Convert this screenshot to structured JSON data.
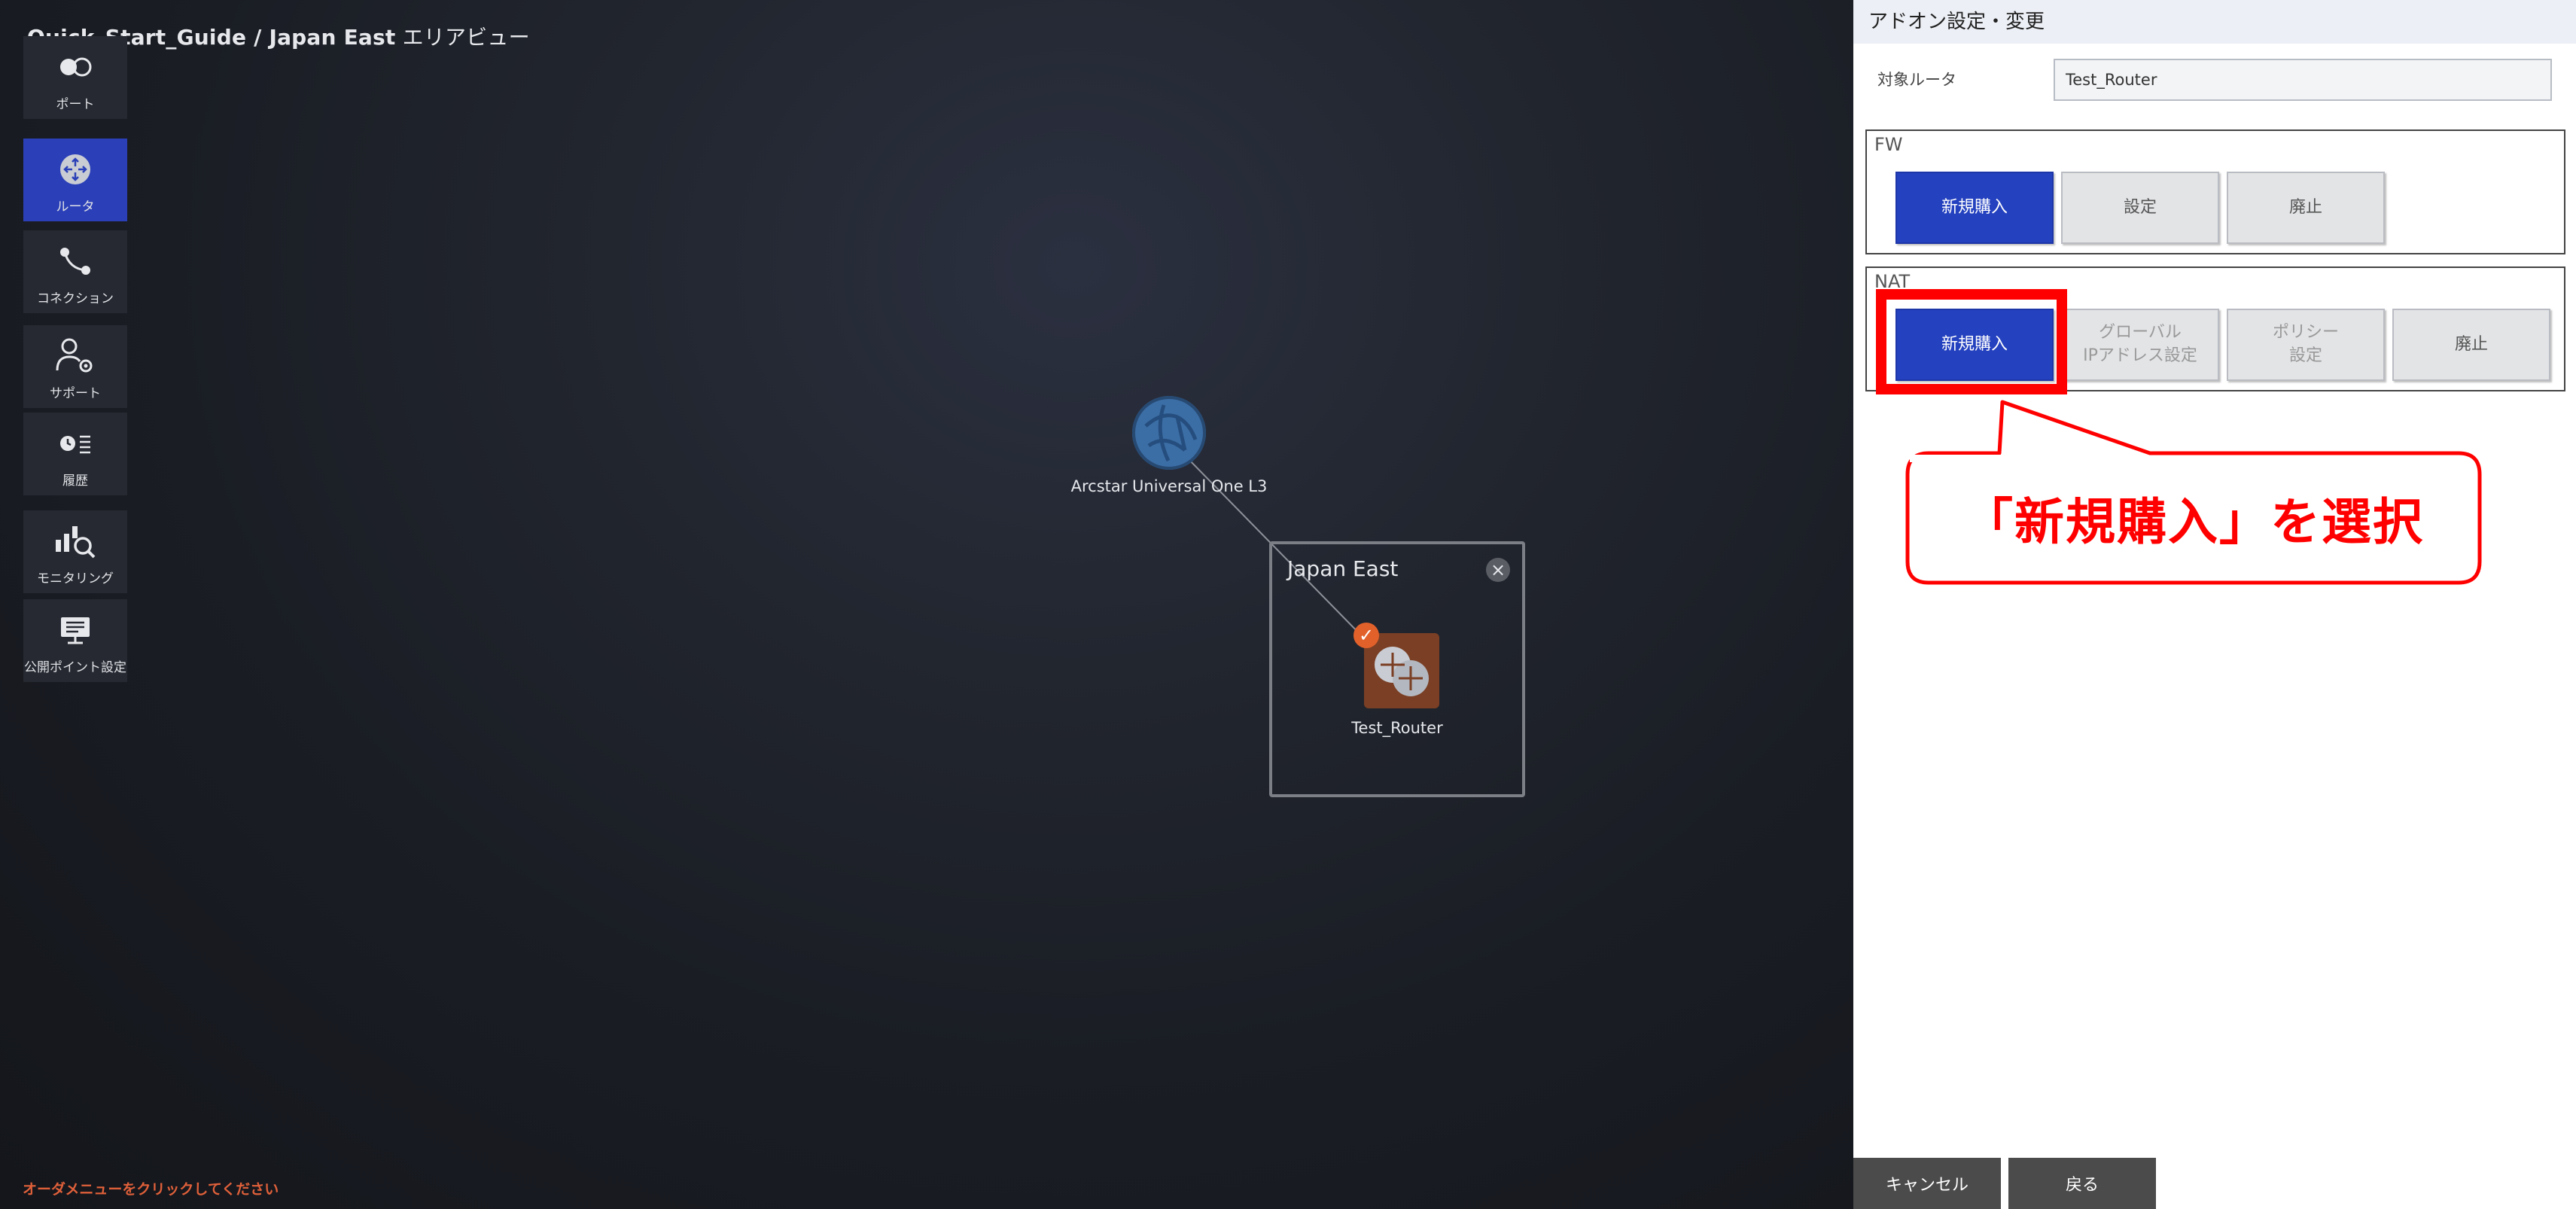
{
  "breadcrumb": {
    "path": "Quick_Start_Guide / Japan East",
    "view": " エリアビュー"
  },
  "sidebar": {
    "items": [
      {
        "label": "ポート",
        "icon": "port-icon"
      },
      {
        "label": "ルータ",
        "icon": "router-icon"
      },
      {
        "label": "コネクション",
        "icon": "connection-icon"
      },
      {
        "label": "サポート",
        "icon": "support-icon"
      },
      {
        "label": "履歴",
        "icon": "history-icon"
      },
      {
        "label": "モニタリング",
        "icon": "monitoring-icon"
      },
      {
        "label": "公開ポイント設定",
        "icon": "public-point-icon"
      }
    ]
  },
  "hint": "オーダメニューをクリックしてください",
  "canvas": {
    "l3_node_label": "Arcstar Universal One L3",
    "area_title": "Japan East",
    "router_label": "Test_Router"
  },
  "panel": {
    "header": "アドオン設定・変更",
    "target_label": "対象ルータ",
    "target_value": "Test_Router",
    "fw": {
      "title": "FW",
      "buttons": [
        "新規購入",
        "設定",
        "廃止"
      ]
    },
    "nat": {
      "title": "NAT",
      "buttons": [
        "新規購入",
        "グローバル\nIPアドレス設定",
        "ポリシー\n設定",
        "廃止"
      ]
    },
    "cancel": "キャンセル",
    "back": "戻る"
  },
  "callout": {
    "text": "「新規購入」を選択",
    "color": "#ff0000"
  },
  "colors": {
    "primary": "#2441bf",
    "active_nav": "#2b40b8",
    "router_node": "#7a3f24",
    "check": "#e2612b"
  }
}
